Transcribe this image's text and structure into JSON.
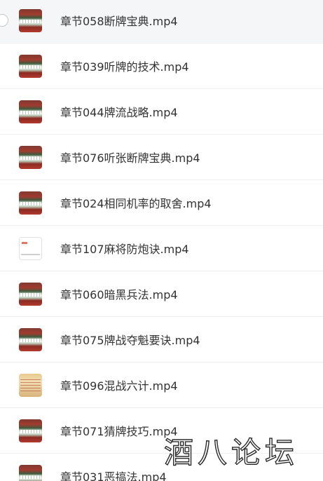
{
  "files": [
    {
      "name": "章节058断牌宝典.mp4",
      "thumb": "video",
      "selected": true
    },
    {
      "name": "章节039听牌的技术.mp4",
      "thumb": "video"
    },
    {
      "name": "章节044牌流战略.mp4",
      "thumb": "video"
    },
    {
      "name": "章节076听张断牌宝典.mp4",
      "thumb": "video"
    },
    {
      "name": "章节024相同机率的取舍.mp4",
      "thumb": "video"
    },
    {
      "name": "章节107麻将防炮诀.mp4",
      "thumb": "document"
    },
    {
      "name": "章节060暗黑兵法.mp4",
      "thumb": "video"
    },
    {
      "name": "章节075牌战夺魁要诀.mp4",
      "thumb": "video"
    },
    {
      "name": "章节096混战六计.mp4",
      "thumb": "paper"
    },
    {
      "name": "章节071猜牌技巧.mp4",
      "thumb": "video"
    },
    {
      "name": "章节031恶搞法.mp4",
      "thumb": "video"
    }
  ],
  "watermark": "酒八论坛"
}
